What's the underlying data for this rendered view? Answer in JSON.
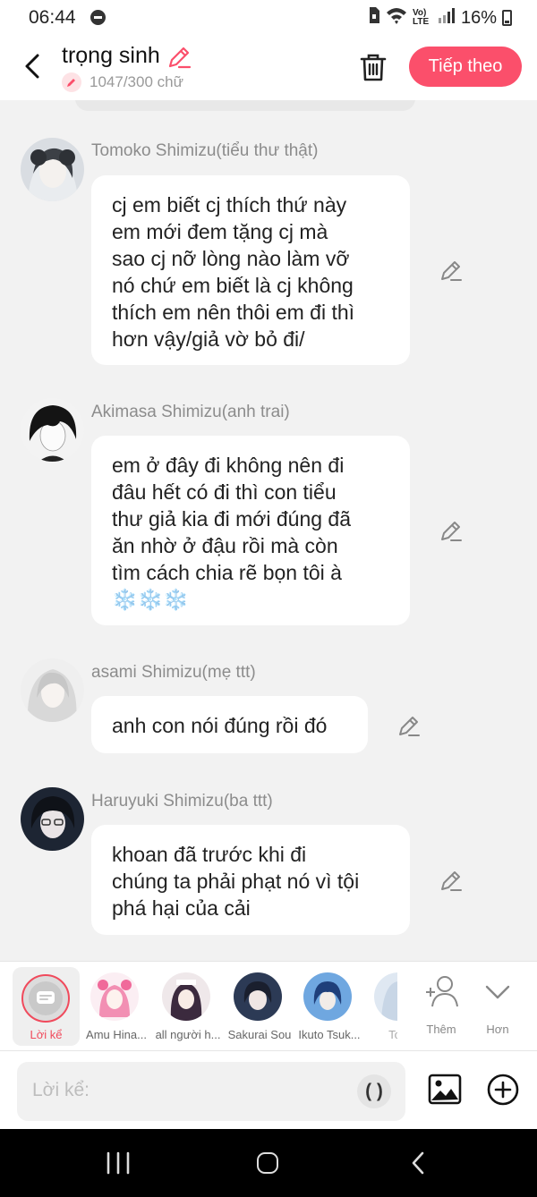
{
  "status_bar": {
    "time": "06:44",
    "network": "Vo) LTE",
    "battery": "16%"
  },
  "header": {
    "title": "trọng sinh",
    "word_count": "1047/300 chữ",
    "next_label": "Tiếp theo",
    "accent_color": "#fb4f6b"
  },
  "messages": [
    {
      "name": "Tomoko Shimizu(tiểu thư thật)",
      "lines": [
        "cj em biết cj thích thứ này",
        "em mới đem tặng cj mà",
        "sao cj nỡ lòng nào làm vỡ",
        "nó chứ em biết là cj không",
        "thích em nên thôi em đi thì",
        "hơn vậy/giả vờ bỏ đi/"
      ]
    },
    {
      "name": "Akimasa Shimizu(anh trai)",
      "lines": [
        "em ở đây đi không nên đi",
        "đâu hết có đi thì con tiểu",
        "thư giả kia đi mới đúng đã",
        "ăn nhờ ở đậu rồi mà còn",
        "tìm cách chia rẽ bọn tôi à",
        "❄️❄️❄️"
      ]
    },
    {
      "name": "asami Shimizu(mẹ ttt)",
      "lines": [
        "anh con nói đúng rồi đó"
      ]
    },
    {
      "name": "Haruyuki Shimizu(ba ttt)",
      "lines": [
        "khoan đã trước khi đi",
        "chúng ta phải phạt nó vì tội",
        "phá hại của cải"
      ]
    }
  ],
  "character_tray": {
    "narrator_label": "Lời kể",
    "characters": [
      "Amu Hina...",
      "all người h...",
      "Sakurai Sou",
      "Ikuto Tsuk...",
      "Tomo"
    ],
    "add_label": "Thêm",
    "more_label": "Hơn"
  },
  "composer": {
    "placeholder": "Lời kể:",
    "paren_label": "( )"
  }
}
